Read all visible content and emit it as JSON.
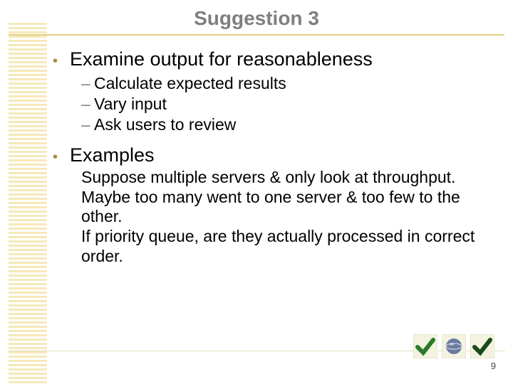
{
  "title": "Suggestion 3",
  "bullets": [
    {
      "text": "Examine output for reasonableness",
      "subs": [
        "Calculate expected results",
        "Vary input",
        "Ask users to review"
      ]
    },
    {
      "text": "Examples",
      "paras": [
        "Suppose multiple servers & only look at throughput.  Maybe too many went to one server & too few to the other.",
        "If priority queue, are they actually processed in correct order."
      ]
    }
  ],
  "page_number": "9"
}
